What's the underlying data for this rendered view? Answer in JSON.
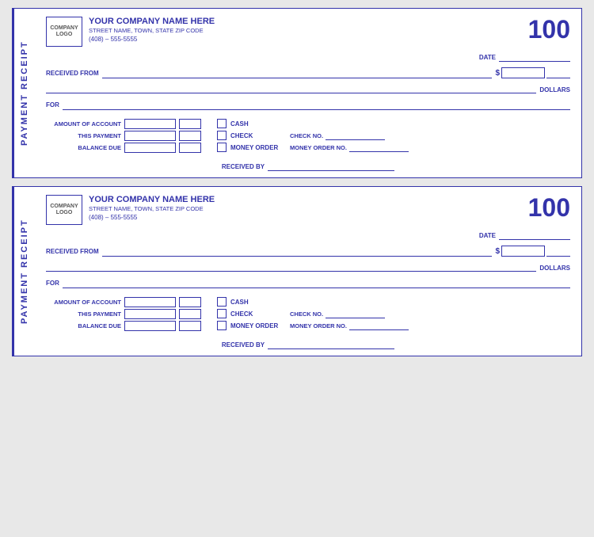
{
  "receipt": {
    "side_label": "PAYMENT RECEIPT",
    "logo_line1": "COMPANY",
    "logo_line2": "LOGO",
    "company_name": "YOUR COMPANY NAME HERE",
    "company_address": "STREET NAME, TOWN, STATE  ZIP CODE",
    "company_phone": "(408) – 555-5555",
    "receipt_number": "100",
    "date_label": "DATE",
    "received_from_label": "RECEIVED FROM",
    "dollar_sign": "$",
    "dollars_label": "DOLLARS",
    "for_label": "FOR",
    "amount_of_account_label": "AMOUNT OF ACCOUNT",
    "this_payment_label": "THIS PAYMENT",
    "balance_due_label": "BALANCE DUE",
    "cash_label": "CASH",
    "check_label": "CHECK",
    "money_order_label": "MONEY ORDER",
    "check_no_label": "CHECK NO.",
    "money_order_no_label": "MONEY ORDER NO.",
    "received_by_label": "RECEIVED BY"
  }
}
